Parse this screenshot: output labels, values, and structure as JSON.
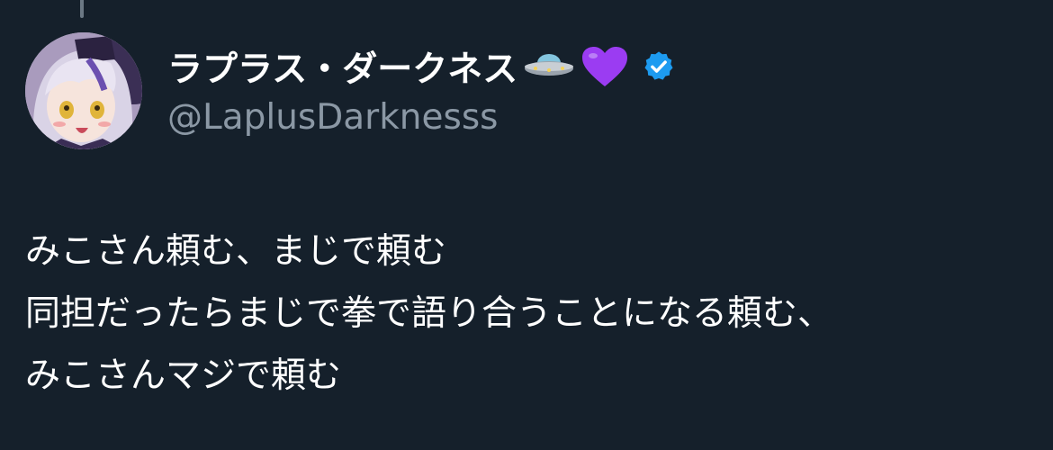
{
  "author": {
    "display_name": "ラプラス・ダークネス",
    "name_emojis": [
      "🛸",
      "💜"
    ],
    "handle": "@LaplusDarknesss",
    "verified": true,
    "verified_icon": "verified-badge-icon",
    "avatar_icon": "anime-character-avatar"
  },
  "tweet": {
    "lines": [
      "みこさん頼む、まじで頼む",
      "同担だったらまじで拳で語り合うことになる頼む、",
      "みこさんマジで頼む"
    ]
  },
  "colors": {
    "background": "#15202b",
    "text_primary": "#ffffff",
    "text_secondary": "#8b98a5",
    "verified_blue": "#1d9bf0",
    "thread_line": "#6b7884"
  }
}
